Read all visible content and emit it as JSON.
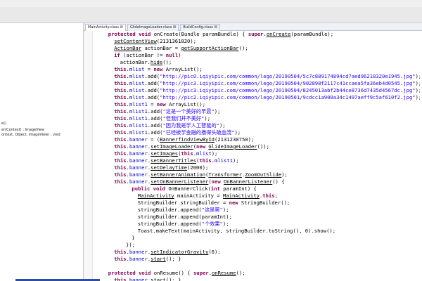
{
  "tabs": [
    {
      "label": "MainActivity.class ☒",
      "active": true
    },
    {
      "label": "GlideImageLoader.class ☒",
      "active": false
    },
    {
      "label": "BuildConfig.class ☒",
      "active": false
    }
  ],
  "left_panel": {
    "rows": [
      "e()",
      "er(Context) : ImageView",
      "ontext, Object, ImageView) : void"
    ]
  },
  "code_lines": [
    {
      "indent": 4,
      "segs": [
        [
          "kw",
          "protected void "
        ],
        [
          "",
          "onCreate(Bundle paramBundle) { "
        ],
        [
          "kw",
          "super"
        ],
        [
          "",
          "."
        ],
        [
          "meth",
          "onCreate"
        ],
        [
          "",
          "(paramBundle);"
        ]
      ]
    },
    {
      "indent": 6,
      "segs": [
        [
          "meth",
          "setContentView"
        ],
        [
          "",
          "(2131361820);"
        ]
      ]
    },
    {
      "indent": 6,
      "segs": [
        [
          "meth",
          "ActionBar"
        ],
        [
          "",
          " actionBar = "
        ],
        [
          "meth",
          "getSupportActionBar"
        ],
        [
          "",
          "();"
        ]
      ]
    },
    {
      "indent": 6,
      "segs": [
        [
          "kw",
          "if"
        ],
        [
          "",
          " (actionBar != "
        ],
        [
          "kw",
          "null"
        ],
        [
          "",
          ")"
        ]
      ]
    },
    {
      "indent": 8,
      "segs": [
        [
          "",
          "actionBar."
        ],
        [
          "meth",
          "hide"
        ],
        [
          "",
          "();"
        ]
      ]
    },
    {
      "indent": 6,
      "segs": [
        [
          "kw",
          "this"
        ],
        [
          "",
          "."
        ],
        [
          "fld",
          "mlist"
        ],
        [
          "",
          " = "
        ],
        [
          "kw",
          "new"
        ],
        [
          "",
          " ArrayList();"
        ]
      ]
    },
    {
      "indent": 6,
      "segs": [
        [
          "kw",
          "this"
        ],
        [
          "",
          "."
        ],
        [
          "fld",
          "mlist"
        ],
        [
          "",
          ".add("
        ],
        [
          "str",
          "\"http://pic0.iqiyipic.com/common/lego/20190504/5c7c889174894cd7aed96218320e1945.jpg\""
        ],
        [
          "",
          ");"
        ]
      ]
    },
    {
      "indent": 6,
      "segs": [
        [
          "kw",
          "this"
        ],
        [
          "",
          "."
        ],
        [
          "fld",
          "mlist"
        ],
        [
          "",
          ".add("
        ],
        [
          "str",
          "\"http://pic3.iqiyipic.com/common/lego/20190504/902898f2117c41ccaea5fa36eb4d0545.jpg\""
        ],
        [
          "",
          ");"
        ]
      ]
    },
    {
      "indent": 6,
      "segs": [
        [
          "kw",
          "this"
        ],
        [
          "",
          "."
        ],
        [
          "fld",
          "mlist"
        ],
        [
          "",
          ".add("
        ],
        [
          "str",
          "\"http://pic3.iqiyipic.com/common/lego/20190504/8245013abf2b44ce8736d7435d4567dc.jpg\""
        ],
        [
          "",
          ");"
        ]
      ]
    },
    {
      "indent": 6,
      "segs": [
        [
          "kw",
          "this"
        ],
        [
          "",
          "."
        ],
        [
          "fld",
          "mlist"
        ],
        [
          "",
          ".add("
        ],
        [
          "str",
          "\"http://pic2.iqiyipic.com/common/lego/20190501/9cdcc1a900a34c1497aeff9c5af610f2.jpg\""
        ],
        [
          "",
          ");"
        ]
      ]
    },
    {
      "indent": 6,
      "segs": [
        [
          "kw",
          "this"
        ],
        [
          "",
          "."
        ],
        [
          "fld",
          "mlist1"
        ],
        [
          "",
          " = "
        ],
        [
          "kw",
          "new"
        ],
        [
          "",
          " ArrayList();"
        ]
      ]
    },
    {
      "indent": 6,
      "segs": [
        [
          "kw",
          "this"
        ],
        [
          "",
          "."
        ],
        [
          "fld",
          "mlist1"
        ],
        [
          "",
          ".add("
        ],
        [
          "str",
          "\"这是一个美好的早晨\""
        ],
        [
          "",
          ");"
        ]
      ]
    },
    {
      "indent": 6,
      "segs": [
        [
          "kw",
          "this"
        ],
        [
          "",
          "."
        ],
        [
          "fld",
          "mlist1"
        ],
        [
          "",
          ".add("
        ],
        [
          "str",
          "\"但我们并不美好\""
        ],
        [
          "",
          ");"
        ]
      ]
    },
    {
      "indent": 6,
      "segs": [
        [
          "kw",
          "this"
        ],
        [
          "",
          "."
        ],
        [
          "fld",
          "mlist1"
        ],
        [
          "",
          ".add("
        ],
        [
          "str",
          "\"因为我是学人工智能的\""
        ],
        [
          "",
          ");"
        ]
      ]
    },
    {
      "indent": 6,
      "segs": [
        [
          "kw",
          "this"
        ],
        [
          "",
          "."
        ],
        [
          "fld",
          "mlist1"
        ],
        [
          "",
          ".add("
        ],
        [
          "str",
          "\"已经被学金融的撸得头破血流\""
        ],
        [
          "",
          ");"
        ]
      ]
    },
    {
      "indent": 6,
      "segs": [
        [
          "kw",
          "this"
        ],
        [
          "",
          "."
        ],
        [
          "fld",
          "banner"
        ],
        [
          "",
          " = ("
        ],
        [
          "meth",
          "Banner"
        ],
        [
          ")"
        ],
        [
          "meth",
          "findViewById"
        ],
        [
          "",
          "(2131230750);"
        ]
      ]
    },
    {
      "indent": 6,
      "segs": [
        [
          "kw",
          "this"
        ],
        [
          "",
          "."
        ],
        [
          "fld",
          "banner"
        ],
        [
          "",
          "."
        ],
        [
          "meth",
          "setImageLoader"
        ],
        [
          "",
          "("
        ],
        [
          "kw",
          "new"
        ],
        [
          "",
          " "
        ],
        [
          "meth",
          "GlideImageLoader"
        ],
        [
          "",
          "());"
        ]
      ]
    },
    {
      "indent": 6,
      "segs": [
        [
          "kw",
          "this"
        ],
        [
          "",
          "."
        ],
        [
          "fld",
          "banner"
        ],
        [
          "",
          "."
        ],
        [
          "meth",
          "setImages"
        ],
        [
          "",
          "("
        ],
        [
          "kw",
          "this"
        ],
        [
          "",
          "."
        ],
        [
          "fld",
          "mlist"
        ],
        [
          "",
          ");"
        ]
      ]
    },
    {
      "indent": 6,
      "segs": [
        [
          "kw",
          "this"
        ],
        [
          "",
          "."
        ],
        [
          "fld",
          "banner"
        ],
        [
          "",
          "."
        ],
        [
          "meth",
          "setBannerTitles"
        ],
        [
          "",
          "("
        ],
        [
          "kw",
          "this"
        ],
        [
          "",
          "."
        ],
        [
          "fld",
          "mlist1"
        ],
        [
          "",
          ");"
        ]
      ]
    },
    {
      "indent": 6,
      "segs": [
        [
          "kw",
          "this"
        ],
        [
          "",
          "."
        ],
        [
          "fld",
          "banner"
        ],
        [
          "",
          "."
        ],
        [
          "meth",
          "setDelayTime"
        ],
        [
          "",
          "(2000);"
        ]
      ]
    },
    {
      "indent": 6,
      "segs": [
        [
          "kw",
          "this"
        ],
        [
          "",
          "."
        ],
        [
          "fld",
          "banner"
        ],
        [
          "",
          "."
        ],
        [
          "meth",
          "setBannerAnimation"
        ],
        [
          "",
          "("
        ],
        [
          "meth",
          "Transformer"
        ],
        [
          "",
          "."
        ],
        [
          "meth",
          "ZoomOutSlide"
        ],
        [
          "",
          ");"
        ]
      ]
    },
    {
      "indent": 6,
      "segs": [
        [
          "kw",
          "this"
        ],
        [
          "",
          "."
        ],
        [
          "fld",
          "banner"
        ],
        [
          "",
          "."
        ],
        [
          "meth",
          "setOnBannerListener"
        ],
        [
          "",
          "("
        ],
        [
          "kw",
          "new"
        ],
        [
          "",
          " "
        ],
        [
          "meth",
          "OnBannerListener"
        ],
        [
          "",
          "() {"
        ]
      ]
    },
    {
      "indent": 12,
      "segs": [
        [
          "kw",
          "public void "
        ],
        [
          "",
          "OnBannerClick("
        ],
        [
          "kw",
          "int"
        ],
        [
          "",
          " paramInt) {"
        ]
      ]
    },
    {
      "indent": 14,
      "segs": [
        [
          "meth",
          "MainActivity"
        ],
        [
          "",
          " mainActivity = "
        ],
        [
          "meth",
          "MainActivity"
        ],
        [
          "",
          "."
        ],
        [
          "kw",
          "this"
        ],
        [
          "",
          ";"
        ]
      ]
    },
    {
      "indent": 14,
      "segs": [
        [
          "",
          "StringBuilder stringBuilder = "
        ],
        [
          "kw",
          "new"
        ],
        [
          "",
          " StringBuilder();"
        ]
      ]
    },
    {
      "indent": 14,
      "segs": [
        [
          "",
          "stringBuilder.append("
        ],
        [
          "str",
          "\"这是第\""
        ],
        [
          "",
          ");"
        ]
      ]
    },
    {
      "indent": 14,
      "segs": [
        [
          "",
          "stringBuilder.append(paramInt);"
        ]
      ]
    },
    {
      "indent": 14,
      "segs": [
        [
          "",
          "stringBuilder.append("
        ],
        [
          "str",
          "\"个效果\""
        ],
        [
          "",
          ");"
        ]
      ]
    },
    {
      "indent": 14,
      "segs": [
        [
          "",
          "Toast.makeText(mainActivity, stringBuilder.toString(), 0).show();"
        ]
      ]
    },
    {
      "indent": 12,
      "segs": [
        [
          "",
          "}"
        ]
      ]
    },
    {
      "indent": 10,
      "segs": [
        [
          "",
          "});"
        ]
      ]
    },
    {
      "indent": 6,
      "segs": [
        [
          "kw",
          "this"
        ],
        [
          "",
          "."
        ],
        [
          "fld",
          "banner"
        ],
        [
          "",
          "."
        ],
        [
          "meth",
          "setIndicatorGravity"
        ],
        [
          "",
          "(6);"
        ]
      ]
    },
    {
      "indent": 6,
      "segs": [
        [
          "kw",
          "this"
        ],
        [
          "",
          "."
        ],
        [
          "fld",
          "banner"
        ],
        [
          "",
          "."
        ],
        [
          "meth",
          "start"
        ],
        [
          "",
          "(); }"
        ]
      ]
    },
    {
      "indent": 4,
      "segs": [
        [
          "",
          ""
        ]
      ]
    },
    {
      "indent": 4,
      "segs": [
        [
          "kw",
          "protected void "
        ],
        [
          "",
          "onResume() { "
        ],
        [
          "kw",
          "super"
        ],
        [
          "",
          "."
        ],
        [
          "meth",
          "onResume"
        ],
        [
          "",
          "();"
        ]
      ]
    },
    {
      "indent": 6,
      "segs": [
        [
          "kw",
          "this"
        ],
        [
          "",
          "."
        ],
        [
          "fld",
          "banner"
        ],
        [
          "",
          "."
        ],
        [
          "meth",
          "start"
        ],
        [
          "",
          "(); }"
        ]
      ]
    }
  ]
}
